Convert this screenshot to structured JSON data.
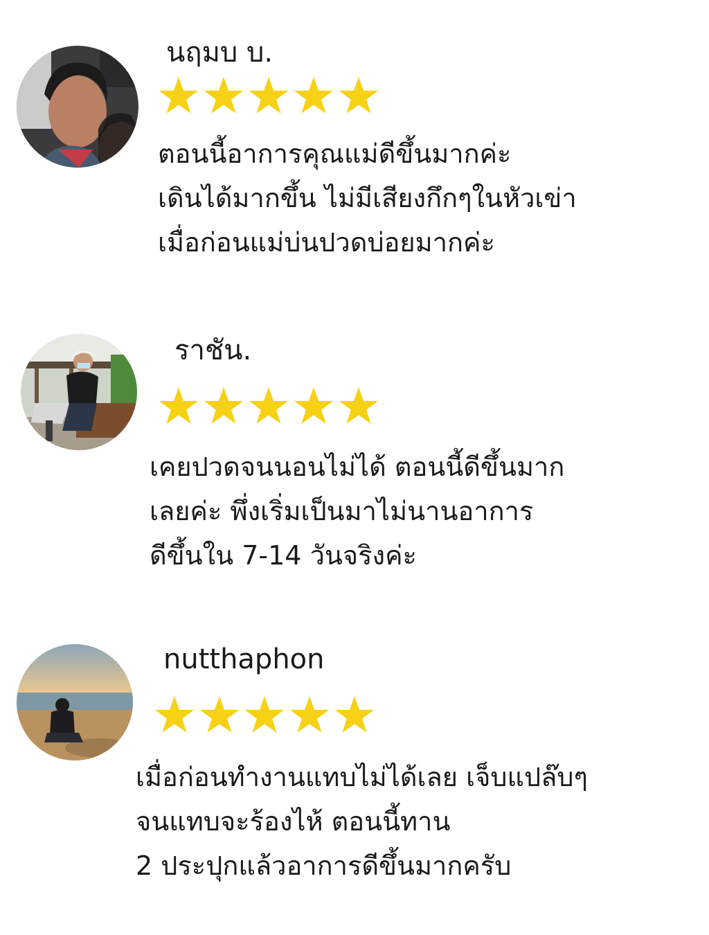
{
  "colors": {
    "star": "#f7d116",
    "text": "#1a1a1a",
    "background": "#ffffff"
  },
  "star_icon": "star-icon",
  "reviews": [
    {
      "name": "นฤมบ บ.",
      "rating": 5,
      "avatar": "avatar-photo",
      "text_lines": [
        "ตอนนี้อาการคุณแม่ดีขึ้นมากค่ะ",
        "เดินได้มากขึ้น ไม่มีเสียงกึกๆในหัวเข่า",
        "เมื่อก่อนแม่บ่นปวดบ่อยมากค่ะ"
      ]
    },
    {
      "name": "ราชัน.",
      "rating": 5,
      "avatar": "avatar-photo",
      "text_lines": [
        "เคยปวดจนนอนไม่ได้ ตอนนี้ดีขึ้นมาก",
        "เลยค่ะ พึ่งเริ่มเป็นมาไม่นานอาการ",
        "ดีขึ้นใน 7-14 วันจริงค่ะ"
      ]
    },
    {
      "name": "nutthaphon",
      "rating": 5,
      "avatar": "avatar-photo",
      "text_lines": [
        "เมื่อก่อนทำงานแทบไม่ได้เลย เจ็บแปล๊บๆ",
        "จนแทบจะร้องไห้ ตอนนี้ทาน",
        "2 ประปุกแล้วอาการดีขึ้นมากครับ"
      ]
    }
  ]
}
